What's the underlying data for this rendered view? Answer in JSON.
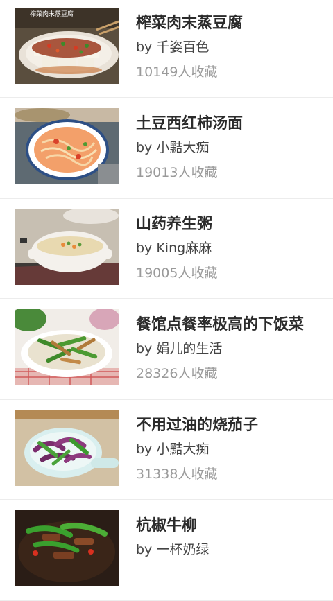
{
  "recipes": [
    {
      "title": "榨菜肉末蒸豆腐",
      "author": "by 千姿百色",
      "favorites": "10149人收藏",
      "image_caption": "榨菜肉末蒸豆腐"
    },
    {
      "title": "土豆西红柿汤面",
      "author": "by 小黠大痴",
      "favorites": "19013人收藏"
    },
    {
      "title": "山药养生粥",
      "author": "by King麻麻",
      "favorites": "19005人收藏"
    },
    {
      "title": "餐馆点餐率极高的下饭菜",
      "author": "by 娟儿的生活",
      "favorites": "28326人收藏"
    },
    {
      "title": "不用过油的烧茄子",
      "author": "by 小黠大痴",
      "favorites": "31338人收藏"
    },
    {
      "title": "杭椒牛柳",
      "author": "by 一杯奶绿",
      "favorites": ""
    }
  ]
}
